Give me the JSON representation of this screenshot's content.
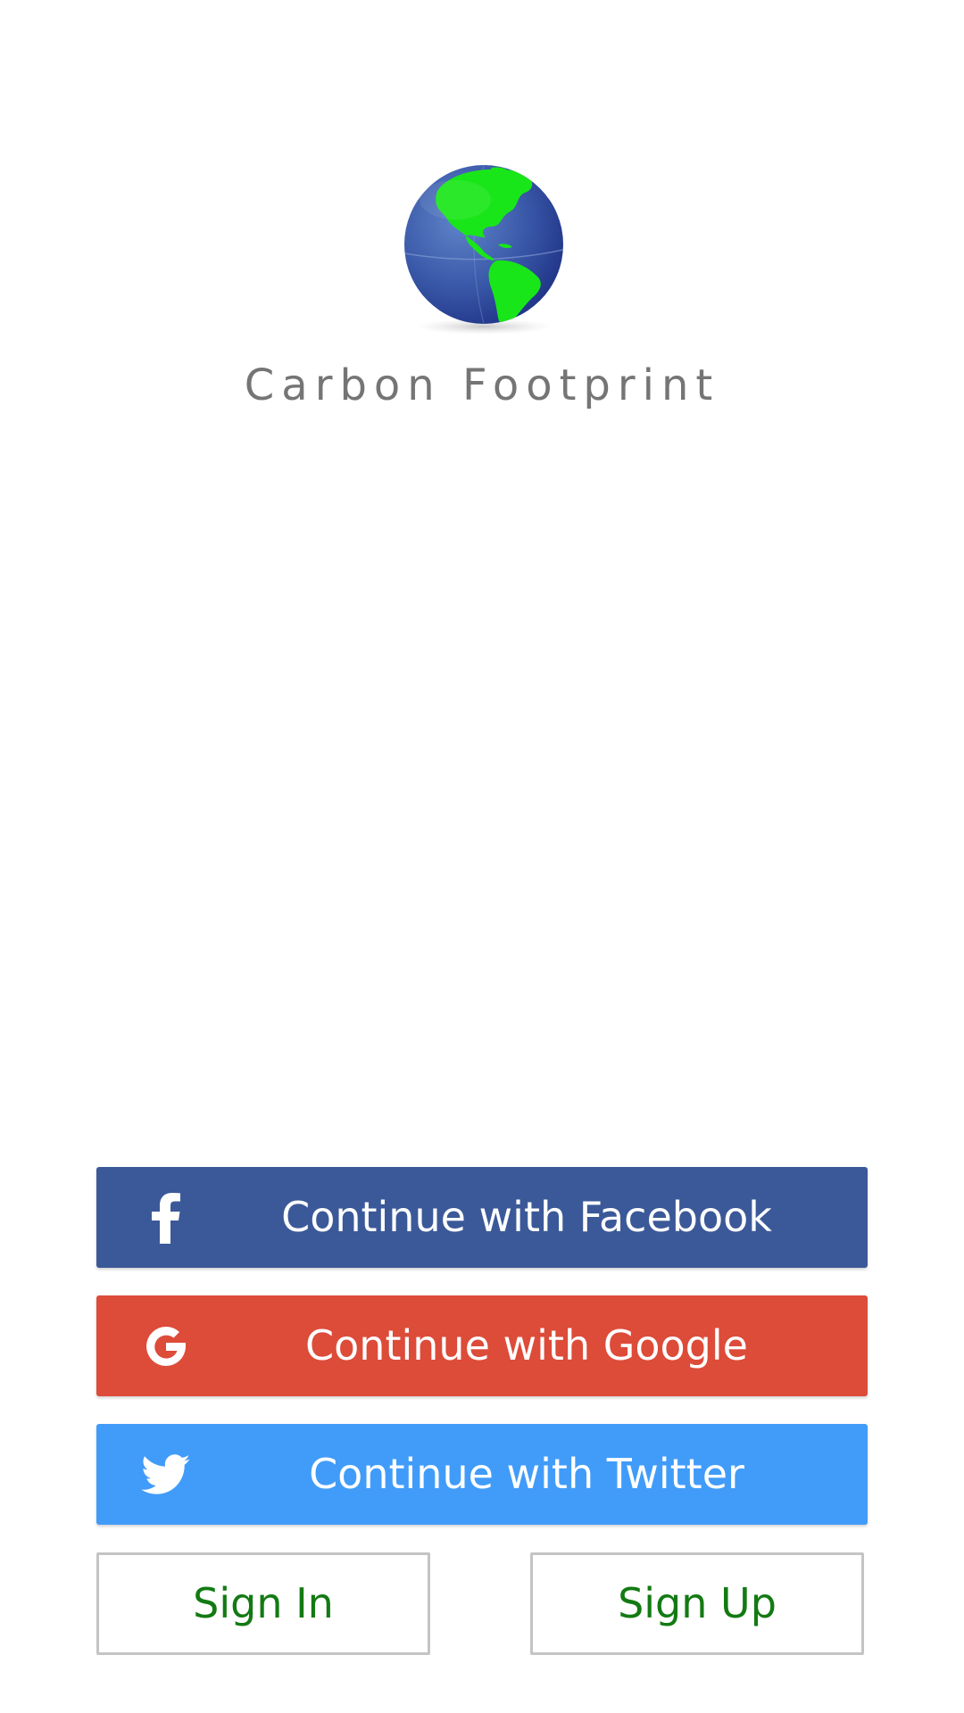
{
  "app": {
    "title": "Carbon Footprint",
    "logo_icon": "globe-icon"
  },
  "social_buttons": {
    "facebook": {
      "label": "Continue with Facebook",
      "icon": "facebook-icon",
      "color": "#3b5998"
    },
    "google": {
      "label": "Continue with Google",
      "icon": "google-icon",
      "color": "#dd4b39"
    },
    "twitter": {
      "label": "Continue with Twitter",
      "icon": "twitter-icon",
      "color": "#419cf9"
    }
  },
  "auth_buttons": {
    "sign_in": {
      "label": "Sign In",
      "color": "#137a13"
    },
    "sign_up": {
      "label": "Sign Up",
      "color": "#137a13"
    }
  }
}
